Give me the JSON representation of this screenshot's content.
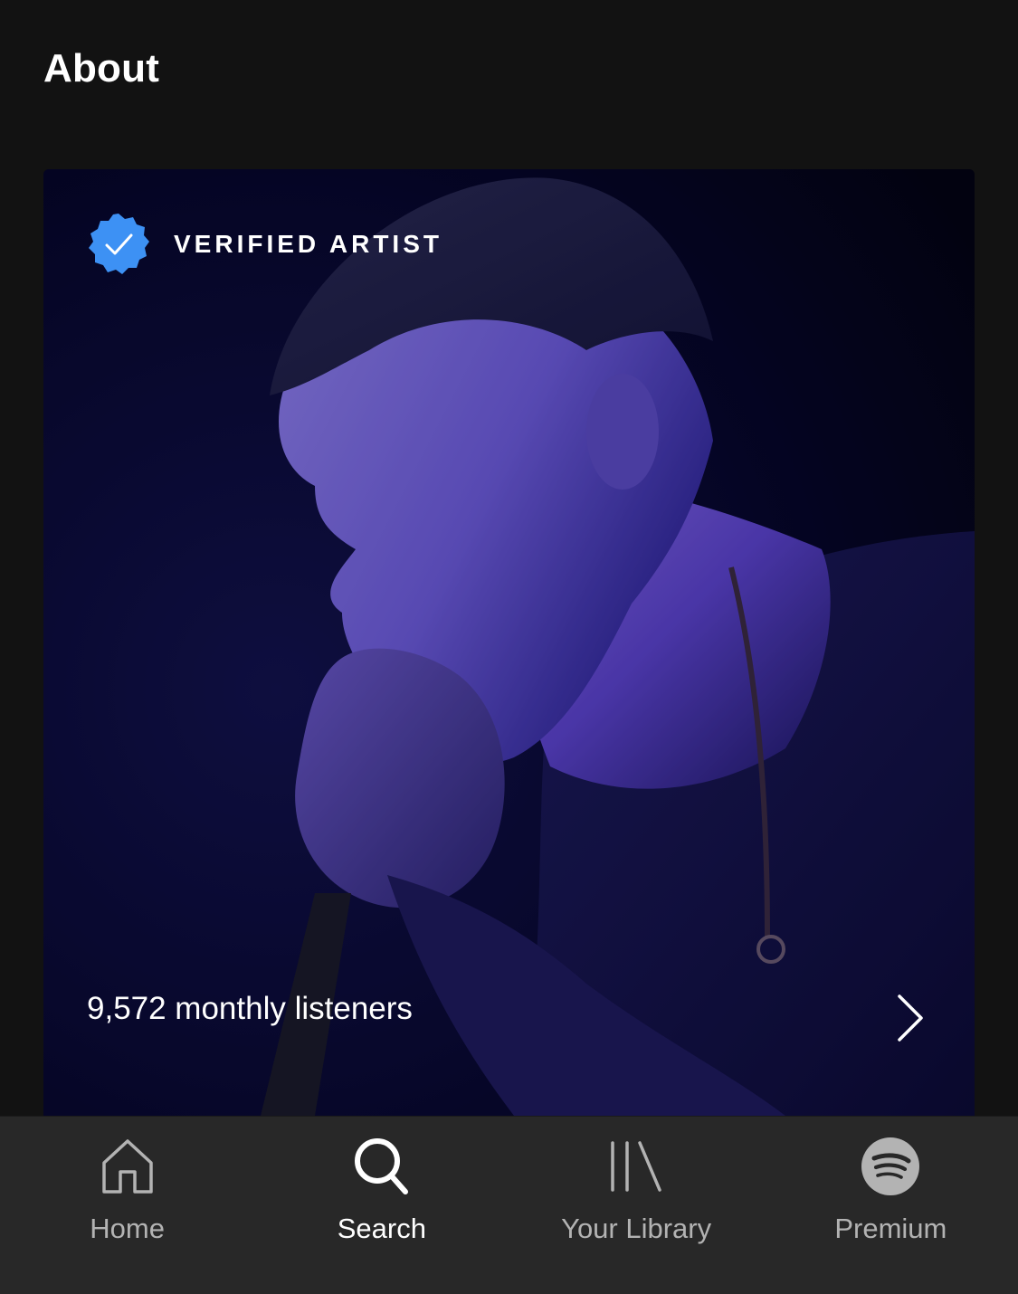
{
  "section": {
    "title": "About"
  },
  "about_card": {
    "verified_label": "VERIFIED ARTIST",
    "monthly_listeners": "9,572 monthly listeners",
    "verified_badge_color": "#3d91f4",
    "open_icon": "chevron-right-icon"
  },
  "tab_bar": {
    "active": "Search",
    "active_color": "#ffffff",
    "inactive_color": "#b3b3b3",
    "tabs": [
      {
        "label": "Home",
        "icon": "home-icon"
      },
      {
        "label": "Search",
        "icon": "search-icon"
      },
      {
        "label": "Your Library",
        "icon": "library-icon"
      },
      {
        "label": "Premium",
        "icon": "spotify-logo-icon"
      }
    ]
  }
}
